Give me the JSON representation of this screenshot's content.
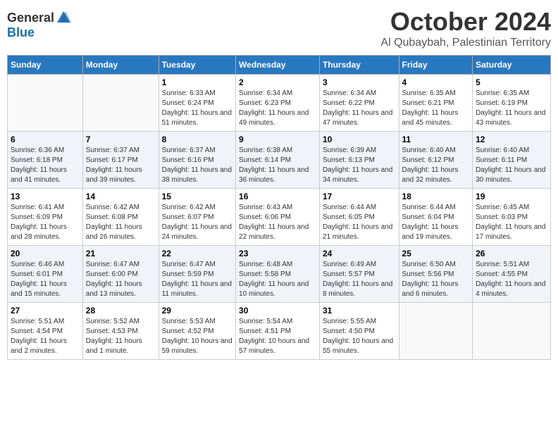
{
  "logo": {
    "general": "General",
    "blue": "Blue"
  },
  "title": {
    "month": "October 2024",
    "location": "Al Qubaybah, Palestinian Territory"
  },
  "headers": [
    "Sunday",
    "Monday",
    "Tuesday",
    "Wednesday",
    "Thursday",
    "Friday",
    "Saturday"
  ],
  "weeks": [
    [
      {
        "day": "",
        "info": ""
      },
      {
        "day": "",
        "info": ""
      },
      {
        "day": "1",
        "info": "Sunrise: 6:33 AM\nSunset: 6:24 PM\nDaylight: 11 hours and 51 minutes."
      },
      {
        "day": "2",
        "info": "Sunrise: 6:34 AM\nSunset: 6:23 PM\nDaylight: 11 hours and 49 minutes."
      },
      {
        "day": "3",
        "info": "Sunrise: 6:34 AM\nSunset: 6:22 PM\nDaylight: 11 hours and 47 minutes."
      },
      {
        "day": "4",
        "info": "Sunrise: 6:35 AM\nSunset: 6:21 PM\nDaylight: 11 hours and 45 minutes."
      },
      {
        "day": "5",
        "info": "Sunrise: 6:35 AM\nSunset: 6:19 PM\nDaylight: 11 hours and 43 minutes."
      }
    ],
    [
      {
        "day": "6",
        "info": "Sunrise: 6:36 AM\nSunset: 6:18 PM\nDaylight: 11 hours and 41 minutes."
      },
      {
        "day": "7",
        "info": "Sunrise: 6:37 AM\nSunset: 6:17 PM\nDaylight: 11 hours and 39 minutes."
      },
      {
        "day": "8",
        "info": "Sunrise: 6:37 AM\nSunset: 6:16 PM\nDaylight: 11 hours and 38 minutes."
      },
      {
        "day": "9",
        "info": "Sunrise: 6:38 AM\nSunset: 6:14 PM\nDaylight: 11 hours and 36 minutes."
      },
      {
        "day": "10",
        "info": "Sunrise: 6:39 AM\nSunset: 6:13 PM\nDaylight: 11 hours and 34 minutes."
      },
      {
        "day": "11",
        "info": "Sunrise: 6:40 AM\nSunset: 6:12 PM\nDaylight: 11 hours and 32 minutes."
      },
      {
        "day": "12",
        "info": "Sunrise: 6:40 AM\nSunset: 6:11 PM\nDaylight: 11 hours and 30 minutes."
      }
    ],
    [
      {
        "day": "13",
        "info": "Sunrise: 6:41 AM\nSunset: 6:09 PM\nDaylight: 11 hours and 28 minutes."
      },
      {
        "day": "14",
        "info": "Sunrise: 6:42 AM\nSunset: 6:08 PM\nDaylight: 11 hours and 26 minutes."
      },
      {
        "day": "15",
        "info": "Sunrise: 6:42 AM\nSunset: 6:07 PM\nDaylight: 11 hours and 24 minutes."
      },
      {
        "day": "16",
        "info": "Sunrise: 6:43 AM\nSunset: 6:06 PM\nDaylight: 11 hours and 22 minutes."
      },
      {
        "day": "17",
        "info": "Sunrise: 6:44 AM\nSunset: 6:05 PM\nDaylight: 11 hours and 21 minutes."
      },
      {
        "day": "18",
        "info": "Sunrise: 6:44 AM\nSunset: 6:04 PM\nDaylight: 11 hours and 19 minutes."
      },
      {
        "day": "19",
        "info": "Sunrise: 6:45 AM\nSunset: 6:03 PM\nDaylight: 11 hours and 17 minutes."
      }
    ],
    [
      {
        "day": "20",
        "info": "Sunrise: 6:46 AM\nSunset: 6:01 PM\nDaylight: 11 hours and 15 minutes."
      },
      {
        "day": "21",
        "info": "Sunrise: 6:47 AM\nSunset: 6:00 PM\nDaylight: 11 hours and 13 minutes."
      },
      {
        "day": "22",
        "info": "Sunrise: 6:47 AM\nSunset: 5:59 PM\nDaylight: 11 hours and 11 minutes."
      },
      {
        "day": "23",
        "info": "Sunrise: 6:48 AM\nSunset: 5:58 PM\nDaylight: 11 hours and 10 minutes."
      },
      {
        "day": "24",
        "info": "Sunrise: 6:49 AM\nSunset: 5:57 PM\nDaylight: 11 hours and 8 minutes."
      },
      {
        "day": "25",
        "info": "Sunrise: 6:50 AM\nSunset: 5:56 PM\nDaylight: 11 hours and 6 minutes."
      },
      {
        "day": "26",
        "info": "Sunrise: 5:51 AM\nSunset: 4:55 PM\nDaylight: 11 hours and 4 minutes."
      }
    ],
    [
      {
        "day": "27",
        "info": "Sunrise: 5:51 AM\nSunset: 4:54 PM\nDaylight: 11 hours and 2 minutes."
      },
      {
        "day": "28",
        "info": "Sunrise: 5:52 AM\nSunset: 4:53 PM\nDaylight: 11 hours and 1 minute."
      },
      {
        "day": "29",
        "info": "Sunrise: 5:53 AM\nSunset: 4:52 PM\nDaylight: 10 hours and 59 minutes."
      },
      {
        "day": "30",
        "info": "Sunrise: 5:54 AM\nSunset: 4:51 PM\nDaylight: 10 hours and 57 minutes."
      },
      {
        "day": "31",
        "info": "Sunrise: 5:55 AM\nSunset: 4:50 PM\nDaylight: 10 hours and 55 minutes."
      },
      {
        "day": "",
        "info": ""
      },
      {
        "day": "",
        "info": ""
      }
    ]
  ]
}
